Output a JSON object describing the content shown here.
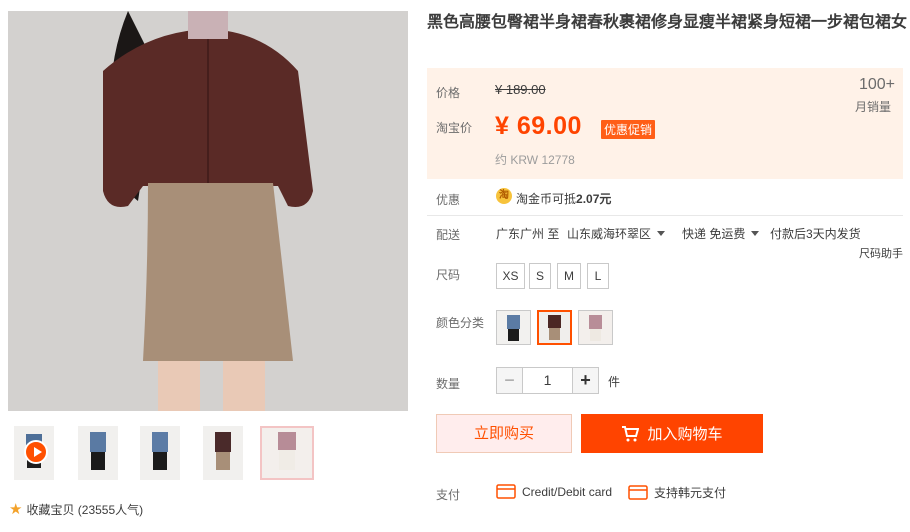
{
  "product": {
    "title": "黑色高腰包臀裙半身裙春秋裹裙修身显瘦半裙紧身短裙一步裙包裙女"
  },
  "price": {
    "label_price": "价格",
    "original": "¥ 189.00",
    "label_taobao": "淘宝价",
    "current": "¥ 69.00",
    "promo_badge": "优惠促销",
    "approx": "约 KRW 12778",
    "sales_count": "100+",
    "sales_label": "月销量"
  },
  "discount": {
    "label": "优惠",
    "coin_icon": "淘",
    "text_prefix": "淘金币可抵",
    "text_amount": "2.07元"
  },
  "delivery": {
    "label": "配送",
    "from": "广东广州 至",
    "to": "山东威海环翠区",
    "shipping": "快递 免运费",
    "dispatch": "付款后3天内发货"
  },
  "size": {
    "label": "尺码",
    "help": "尺码助手",
    "options": [
      "XS",
      "S",
      "M",
      "L"
    ]
  },
  "color": {
    "label": "颜色分类",
    "options": [
      "blue-shirt-black-skirt",
      "brown-shirt-khaki-skirt",
      "pink-shirt-white-skirt"
    ],
    "selected_index": 1
  },
  "quantity": {
    "label": "数量",
    "minus": "−",
    "value": "1",
    "plus": "+",
    "unit": "件"
  },
  "buttons": {
    "buy_now": "立即购买",
    "add_cart": "加入购物车"
  },
  "payment": {
    "label": "支付",
    "methods": [
      "Credit/Debit card",
      "支持韩元支付"
    ]
  },
  "favorite": {
    "text": "收藏宝贝 (23555人气)"
  },
  "colors": {
    "accent": "#ff4400",
    "price_bg": "#fff2e8",
    "promo": "#ff5e17"
  }
}
